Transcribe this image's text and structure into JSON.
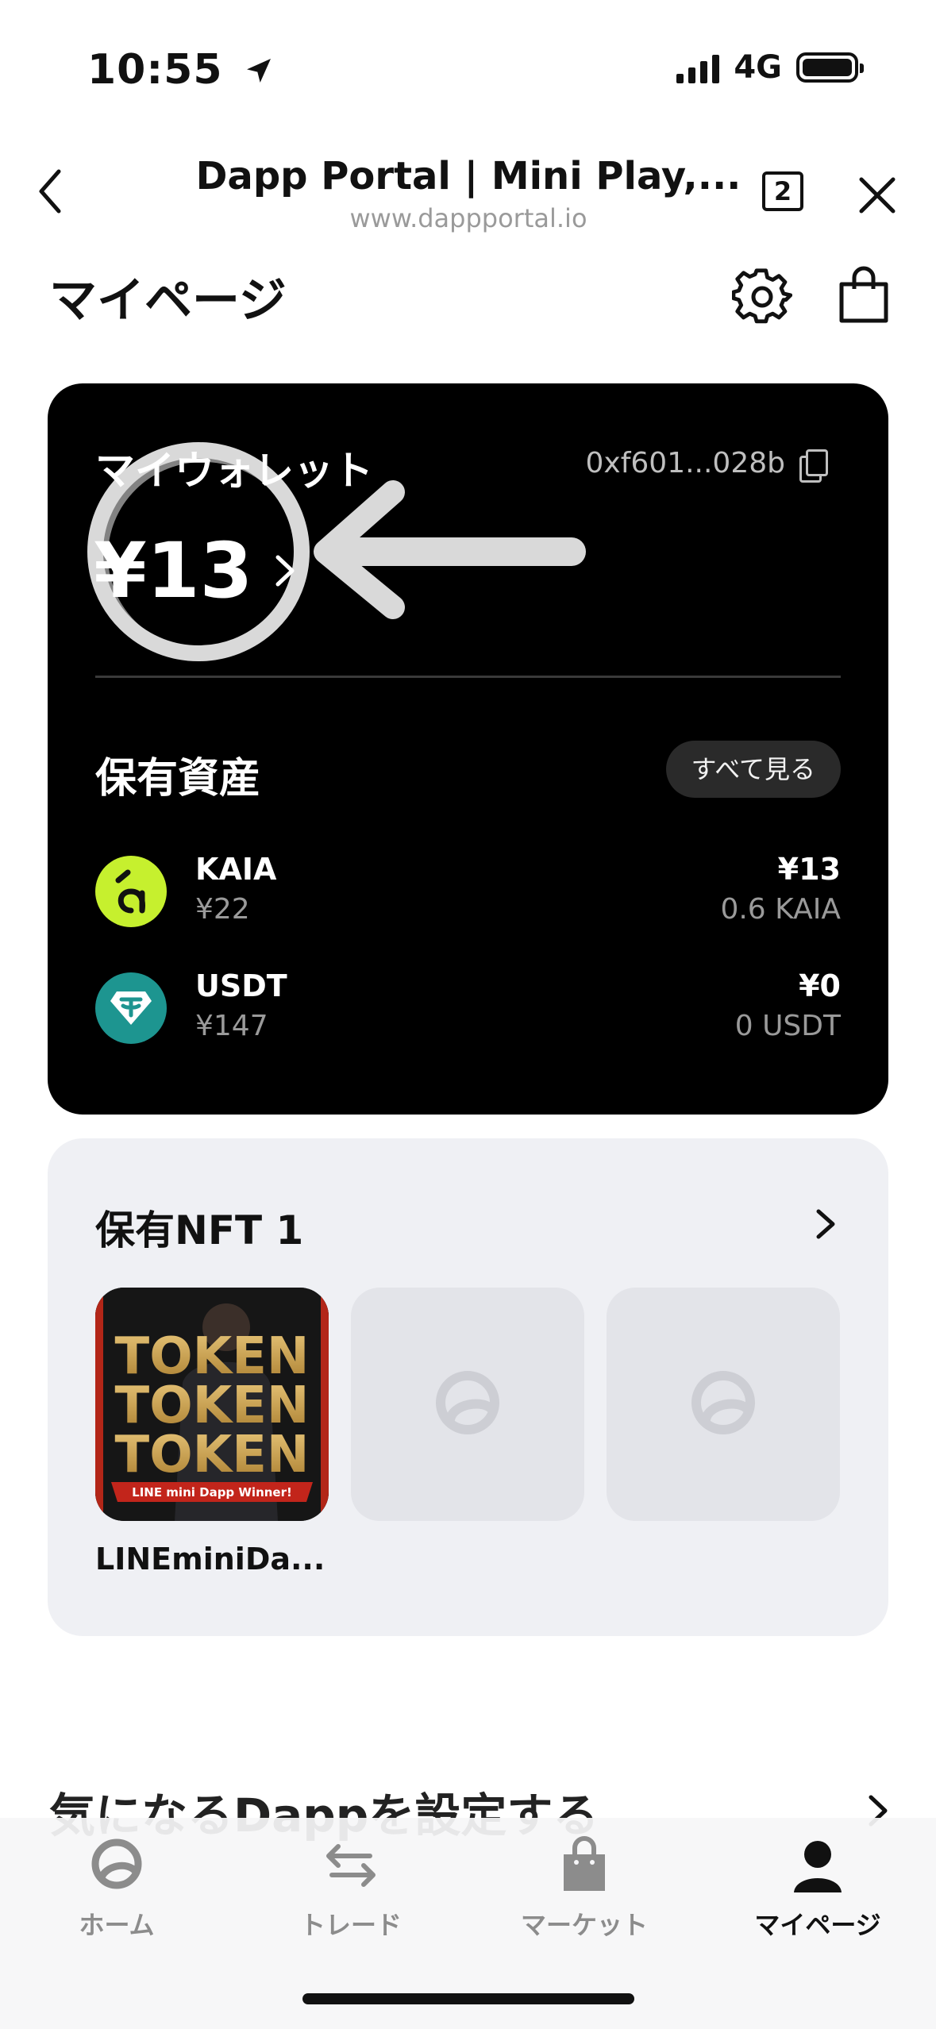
{
  "status_bar": {
    "time": "10:55",
    "network": "4G"
  },
  "browser": {
    "title": "Dapp Portal | Mini Play,...",
    "url": "www.dappportal.io",
    "tab_count": "2"
  },
  "page": {
    "title": "マイページ"
  },
  "wallet": {
    "title": "マイウォレット",
    "address": "0xf601...028b",
    "balance": "¥13",
    "assets_title": "保有資産",
    "view_all_label": "すべて見る",
    "assets": [
      {
        "name": "KAIA",
        "rate": "¥22",
        "value": "¥13",
        "amount": "0.6 KAIA"
      },
      {
        "name": "USDT",
        "rate": "¥147",
        "value": "¥0",
        "amount": "0 USDT"
      }
    ]
  },
  "nft": {
    "title": "保有NFT 1",
    "items": [
      {
        "name": "LINEminiDa..."
      }
    ],
    "image_text": {
      "line1": "TOKEN",
      "line2": "TOKEN",
      "line3": "TOKEN",
      "banner": "LINE mini Dapp Winner!"
    }
  },
  "dapp_section": {
    "title": "気になるDappを設定する"
  },
  "bottom_nav": [
    {
      "label": "ホーム",
      "icon": "home-icon"
    },
    {
      "label": "トレード",
      "icon": "trade-icon"
    },
    {
      "label": "マーケット",
      "icon": "bag-icon"
    },
    {
      "label": "マイページ",
      "icon": "user-icon",
      "active": true
    }
  ],
  "colors": {
    "kaia": "#c6f02e",
    "usdt": "#1d9590",
    "card_dark": "#000000",
    "nft_card": "#eff0f4"
  }
}
